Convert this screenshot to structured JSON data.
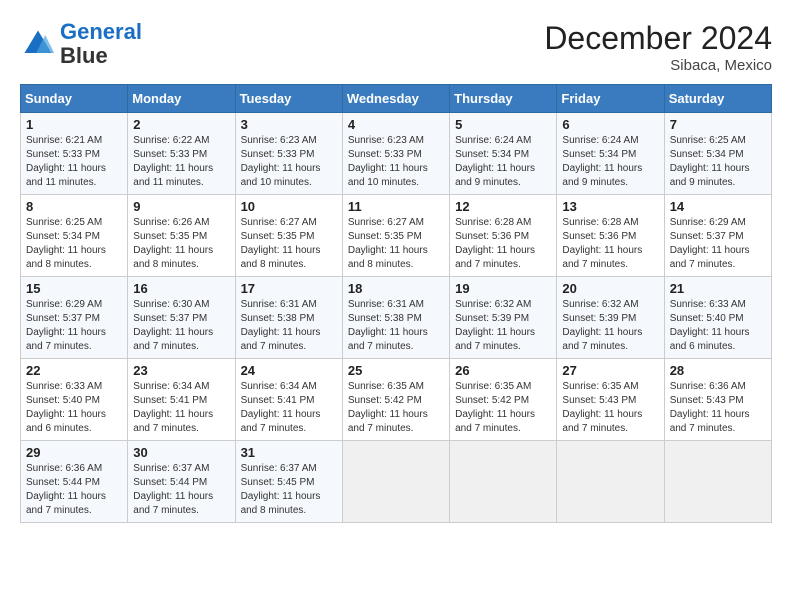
{
  "header": {
    "logo_line1": "General",
    "logo_line2": "Blue",
    "month": "December 2024",
    "location": "Sibaca, Mexico"
  },
  "days_of_week": [
    "Sunday",
    "Monday",
    "Tuesday",
    "Wednesday",
    "Thursday",
    "Friday",
    "Saturday"
  ],
  "weeks": [
    [
      {
        "day": "1",
        "info": "Sunrise: 6:21 AM\nSunset: 5:33 PM\nDaylight: 11 hours\nand 11 minutes."
      },
      {
        "day": "2",
        "info": "Sunrise: 6:22 AM\nSunset: 5:33 PM\nDaylight: 11 hours\nand 11 minutes."
      },
      {
        "day": "3",
        "info": "Sunrise: 6:23 AM\nSunset: 5:33 PM\nDaylight: 11 hours\nand 10 minutes."
      },
      {
        "day": "4",
        "info": "Sunrise: 6:23 AM\nSunset: 5:33 PM\nDaylight: 11 hours\nand 10 minutes."
      },
      {
        "day": "5",
        "info": "Sunrise: 6:24 AM\nSunset: 5:34 PM\nDaylight: 11 hours\nand 9 minutes."
      },
      {
        "day": "6",
        "info": "Sunrise: 6:24 AM\nSunset: 5:34 PM\nDaylight: 11 hours\nand 9 minutes."
      },
      {
        "day": "7",
        "info": "Sunrise: 6:25 AM\nSunset: 5:34 PM\nDaylight: 11 hours\nand 9 minutes."
      }
    ],
    [
      {
        "day": "8",
        "info": "Sunrise: 6:25 AM\nSunset: 5:34 PM\nDaylight: 11 hours\nand 8 minutes."
      },
      {
        "day": "9",
        "info": "Sunrise: 6:26 AM\nSunset: 5:35 PM\nDaylight: 11 hours\nand 8 minutes."
      },
      {
        "day": "10",
        "info": "Sunrise: 6:27 AM\nSunset: 5:35 PM\nDaylight: 11 hours\nand 8 minutes."
      },
      {
        "day": "11",
        "info": "Sunrise: 6:27 AM\nSunset: 5:35 PM\nDaylight: 11 hours\nand 8 minutes."
      },
      {
        "day": "12",
        "info": "Sunrise: 6:28 AM\nSunset: 5:36 PM\nDaylight: 11 hours\nand 7 minutes."
      },
      {
        "day": "13",
        "info": "Sunrise: 6:28 AM\nSunset: 5:36 PM\nDaylight: 11 hours\nand 7 minutes."
      },
      {
        "day": "14",
        "info": "Sunrise: 6:29 AM\nSunset: 5:37 PM\nDaylight: 11 hours\nand 7 minutes."
      }
    ],
    [
      {
        "day": "15",
        "info": "Sunrise: 6:29 AM\nSunset: 5:37 PM\nDaylight: 11 hours\nand 7 minutes."
      },
      {
        "day": "16",
        "info": "Sunrise: 6:30 AM\nSunset: 5:37 PM\nDaylight: 11 hours\nand 7 minutes."
      },
      {
        "day": "17",
        "info": "Sunrise: 6:31 AM\nSunset: 5:38 PM\nDaylight: 11 hours\nand 7 minutes."
      },
      {
        "day": "18",
        "info": "Sunrise: 6:31 AM\nSunset: 5:38 PM\nDaylight: 11 hours\nand 7 minutes."
      },
      {
        "day": "19",
        "info": "Sunrise: 6:32 AM\nSunset: 5:39 PM\nDaylight: 11 hours\nand 7 minutes."
      },
      {
        "day": "20",
        "info": "Sunrise: 6:32 AM\nSunset: 5:39 PM\nDaylight: 11 hours\nand 7 minutes."
      },
      {
        "day": "21",
        "info": "Sunrise: 6:33 AM\nSunset: 5:40 PM\nDaylight: 11 hours\nand 6 minutes."
      }
    ],
    [
      {
        "day": "22",
        "info": "Sunrise: 6:33 AM\nSunset: 5:40 PM\nDaylight: 11 hours\nand 6 minutes."
      },
      {
        "day": "23",
        "info": "Sunrise: 6:34 AM\nSunset: 5:41 PM\nDaylight: 11 hours\nand 7 minutes."
      },
      {
        "day": "24",
        "info": "Sunrise: 6:34 AM\nSunset: 5:41 PM\nDaylight: 11 hours\nand 7 minutes."
      },
      {
        "day": "25",
        "info": "Sunrise: 6:35 AM\nSunset: 5:42 PM\nDaylight: 11 hours\nand 7 minutes."
      },
      {
        "day": "26",
        "info": "Sunrise: 6:35 AM\nSunset: 5:42 PM\nDaylight: 11 hours\nand 7 minutes."
      },
      {
        "day": "27",
        "info": "Sunrise: 6:35 AM\nSunset: 5:43 PM\nDaylight: 11 hours\nand 7 minutes."
      },
      {
        "day": "28",
        "info": "Sunrise: 6:36 AM\nSunset: 5:43 PM\nDaylight: 11 hours\nand 7 minutes."
      }
    ],
    [
      {
        "day": "29",
        "info": "Sunrise: 6:36 AM\nSunset: 5:44 PM\nDaylight: 11 hours\nand 7 minutes."
      },
      {
        "day": "30",
        "info": "Sunrise: 6:37 AM\nSunset: 5:44 PM\nDaylight: 11 hours\nand 7 minutes."
      },
      {
        "day": "31",
        "info": "Sunrise: 6:37 AM\nSunset: 5:45 PM\nDaylight: 11 hours\nand 8 minutes."
      },
      {
        "day": "",
        "info": ""
      },
      {
        "day": "",
        "info": ""
      },
      {
        "day": "",
        "info": ""
      },
      {
        "day": "",
        "info": ""
      }
    ]
  ]
}
